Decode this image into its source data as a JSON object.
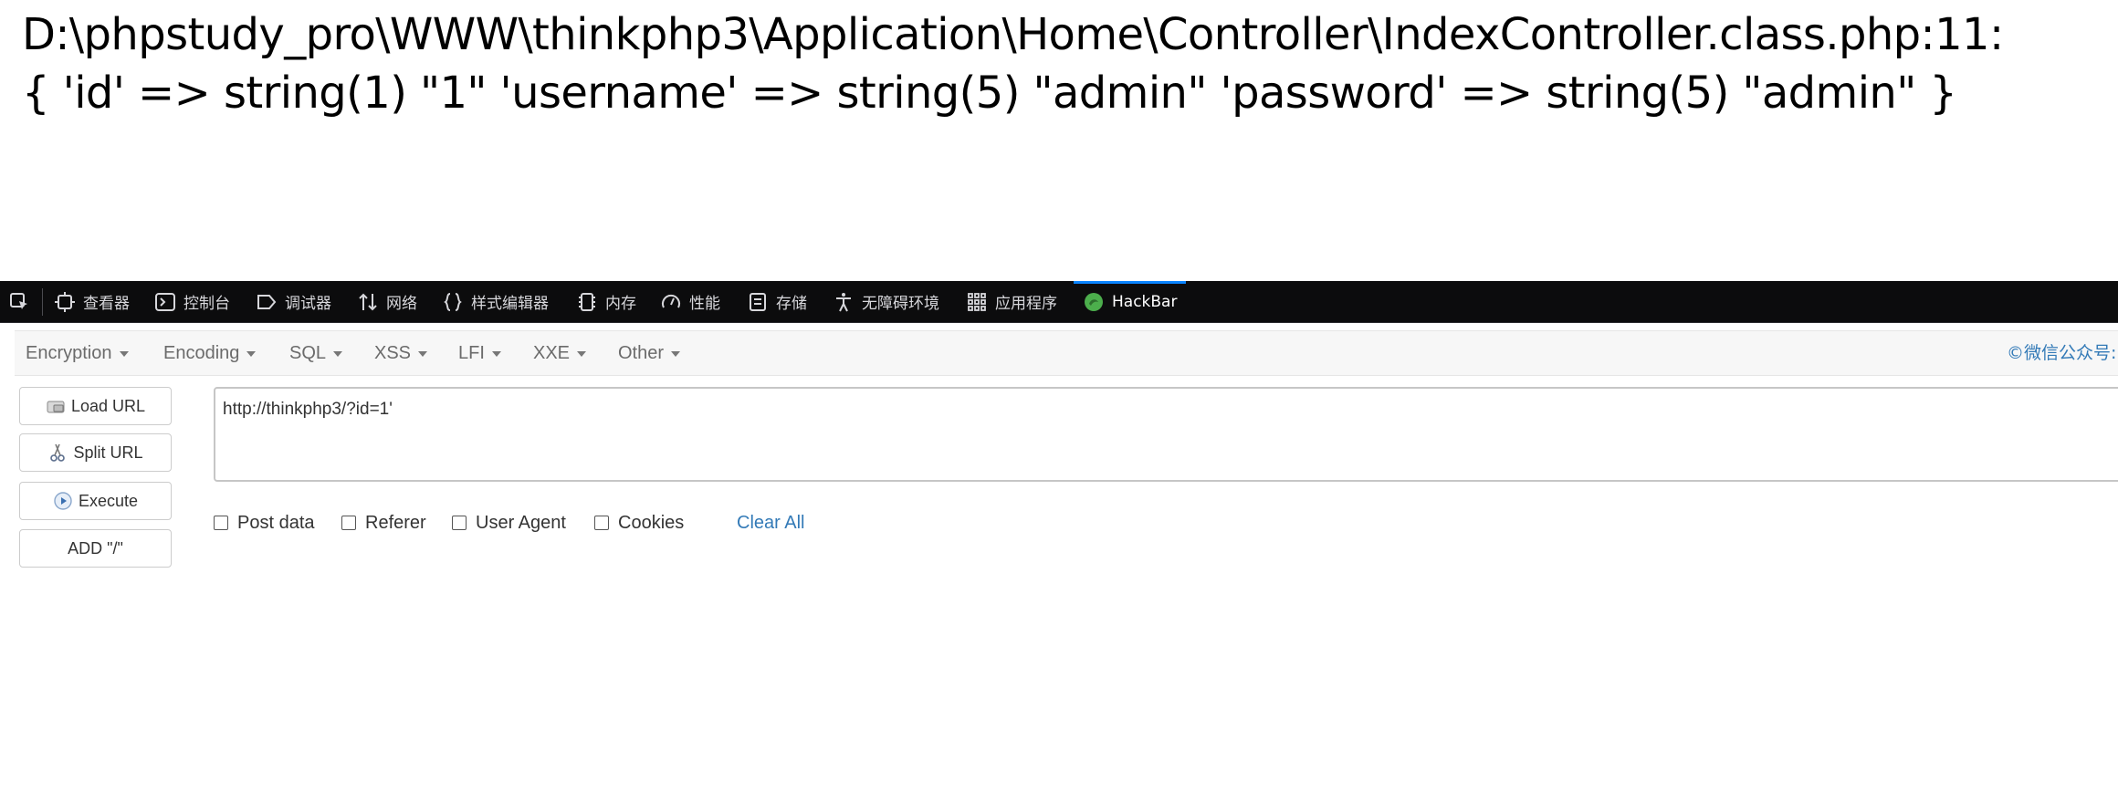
{
  "output": {
    "line1": "D:\\phpstudy_pro\\WWW\\thinkphp3\\Application\\Home\\Controller\\IndexController.class.php:11:",
    "line2": "{ 'id' => string(1) \"1\" 'username' => string(5) \"admin\" 'password' => string(5) \"admin\" }"
  },
  "devtools": {
    "tabs": [
      {
        "label": "查看器",
        "icon": "inspector-icon"
      },
      {
        "label": "控制台",
        "icon": "console-icon"
      },
      {
        "label": "调试器",
        "icon": "debugger-icon"
      },
      {
        "label": "网络",
        "icon": "network-icon"
      },
      {
        "label": "样式编辑器",
        "icon": "style-editor-icon"
      },
      {
        "label": "内存",
        "icon": "memory-icon"
      },
      {
        "label": "性能",
        "icon": "performance-icon"
      },
      {
        "label": "存储",
        "icon": "storage-icon"
      },
      {
        "label": "无障碍环境",
        "icon": "accessibility-icon"
      },
      {
        "label": "应用程序",
        "icon": "application-icon"
      },
      {
        "label": "HackBar",
        "icon": "hackbar-icon"
      }
    ],
    "active_tab": "HackBar",
    "accent_color": "#0a84ff"
  },
  "hackbar": {
    "menus": [
      "Encryption",
      "Encoding",
      "SQL",
      "XSS",
      "LFI",
      "XXE",
      "Other"
    ],
    "credit": "©微信公众号: ",
    "buttons": {
      "load_url": "Load URL",
      "split_url": "Split URL",
      "execute": "Execute",
      "add_slash": "ADD \"/\""
    },
    "url_value": "http://thinkphp3/?id=1'",
    "checkboxes": {
      "post_data": "Post data",
      "referer": "Referer",
      "user_agent": "User Agent",
      "cookies": "Cookies"
    },
    "clear_all": "Clear All",
    "link_color": "#337ab7"
  }
}
